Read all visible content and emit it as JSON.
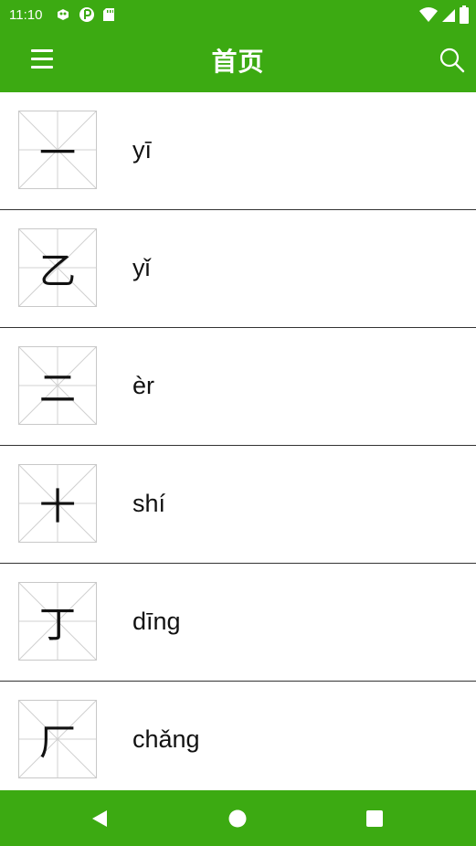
{
  "status_bar": {
    "time": "11:10",
    "icons_left": [
      "bug-icon",
      "p-badge-icon",
      "sd-card-icon"
    ],
    "icons_right": [
      "wifi-icon",
      "signal-icon",
      "battery-icon"
    ]
  },
  "app_bar": {
    "title": "首页",
    "menu_icon": "menu-icon",
    "search_icon": "search-icon"
  },
  "list": {
    "items": [
      {
        "character": "一",
        "pinyin": "yī"
      },
      {
        "character": "乙",
        "pinyin": "yǐ"
      },
      {
        "character": "二",
        "pinyin": "èr"
      },
      {
        "character": "十",
        "pinyin": "shí"
      },
      {
        "character": "丁",
        "pinyin": "dīng"
      },
      {
        "character": "厂",
        "pinyin": "chǎng"
      }
    ]
  },
  "nav_bar": {
    "buttons": [
      "back-icon",
      "home-icon",
      "recents-icon"
    ]
  },
  "colors": {
    "primary": "#3caa12",
    "divider": "#333333",
    "grid": "#c8c8c8"
  }
}
